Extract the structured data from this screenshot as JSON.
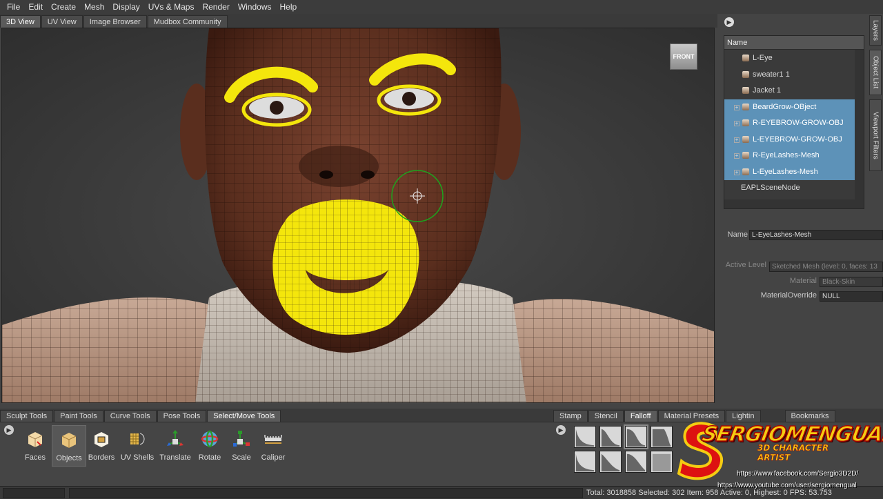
{
  "menu": [
    "File",
    "Edit",
    "Create",
    "Mesh",
    "Display",
    "UVs & Maps",
    "Render",
    "Windows",
    "Help"
  ],
  "view_tabs": [
    "3D View",
    "UV View",
    "Image Browser",
    "Mudbox Community"
  ],
  "viewcube_label": "FRONT",
  "side_tabs": [
    "Layers",
    "Object List",
    "Viewport Filters"
  ],
  "object_list": {
    "header": "Name",
    "rows": [
      {
        "label": "L-Eye",
        "selected": false
      },
      {
        "label": "sweater1 1",
        "selected": false
      },
      {
        "label": "Jacket 1",
        "selected": false
      },
      {
        "label": "BeardGrow-OBject",
        "selected": true
      },
      {
        "label": "R-EYEBROW-GROW-OBJ",
        "selected": true
      },
      {
        "label": "L-EYEBROW-GROW-OBJ",
        "selected": true
      },
      {
        "label": "R-EyeLashes-Mesh",
        "selected": true
      },
      {
        "label": "L-EyeLashes-Mesh",
        "selected": true
      },
      {
        "label": "EAPLSceneNode",
        "selected": false
      }
    ]
  },
  "properties": {
    "name_label": "Name",
    "name_value": "L-EyeLashes-Mesh",
    "active_level_label": "Active Level",
    "active_level_value": "Sketched Mesh (level: 0, faces: 13",
    "material_label": "Material",
    "material_value": "Black-Skin",
    "material_override_label": "MaterialOverride",
    "material_override_value": "NULL"
  },
  "tool_tabs": [
    "Sculpt Tools",
    "Paint Tools",
    "Curve Tools",
    "Pose Tools",
    "Select/Move Tools"
  ],
  "tools": [
    "Faces",
    "Objects",
    "Borders",
    "UV Shells",
    "Translate",
    "Rotate",
    "Scale",
    "Caliper"
  ],
  "right_tabs": [
    "Stamp",
    "Stencil",
    "Falloff",
    "Material Presets",
    "Lightin",
    "Bookmarks"
  ],
  "status": {
    "text": "Total: 3018858  Selected: 302      Item: 958  Active: 0, Highest: 0  FPS: 53.753"
  },
  "logo": {
    "title": "SERGIOMENGUAL",
    "subtitle": "3D CHARACTER ARTIST",
    "facebook": "https://www.facebook.com/Sergio3D2D/",
    "youtube": "https://www.youtube.com/user/sergiomengual"
  },
  "colors": {
    "selection": "#5d92b8",
    "accent_yellow": "#f4e60c",
    "skin": "#6b3a28"
  }
}
